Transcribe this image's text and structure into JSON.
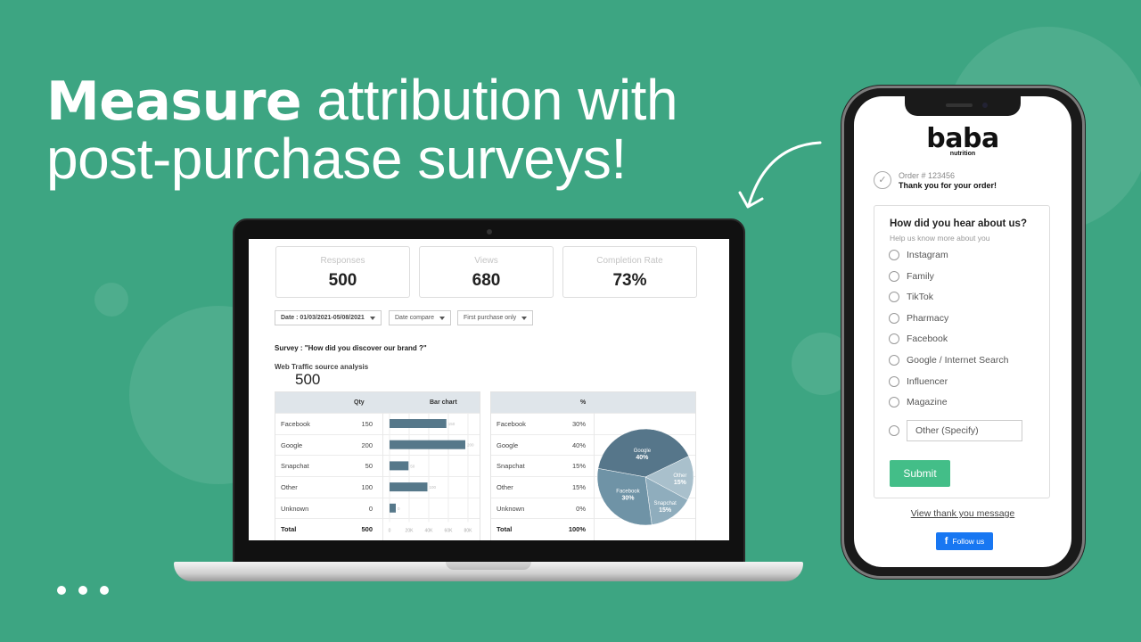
{
  "headline": {
    "bold": "Measure",
    "line1_rest": " attribution with",
    "line2": "post-purchase surveys!"
  },
  "dashboard": {
    "kpis": [
      {
        "label": "Responses",
        "value": "500"
      },
      {
        "label": "Views",
        "value": "680"
      },
      {
        "label": "Completion Rate",
        "value": "73%"
      }
    ],
    "filters": [
      {
        "label": "Date : 01/03/2021-05/08/2021"
      },
      {
        "label": "Date compare"
      },
      {
        "label": "First purchase only"
      }
    ],
    "survey_title": "Survey : \"How did you discover our brand ?\"",
    "analysis_label": "Web Traffic source analysis",
    "analysis_total": "500",
    "qty_table": {
      "headers": [
        "",
        "Qty",
        "Bar chart"
      ],
      "rows": [
        {
          "name": "Facebook",
          "qty": "150"
        },
        {
          "name": "Google",
          "qty": "200"
        },
        {
          "name": "Snapchat",
          "qty": "50"
        },
        {
          "name": "Other",
          "qty": "100"
        },
        {
          "name": "Unknown",
          "qty": "0"
        }
      ],
      "total": {
        "name": "Total",
        "qty": "500"
      }
    },
    "pct_table": {
      "headers": [
        "",
        "%"
      ],
      "rows": [
        {
          "name": "Facebook",
          "pct": "30%"
        },
        {
          "name": "Google",
          "pct": "40%"
        },
        {
          "name": "Snapchat",
          "pct": "15%"
        },
        {
          "name": "Other",
          "pct": "15%"
        },
        {
          "name": "Unknown",
          "pct": "0%"
        }
      ],
      "total": {
        "name": "Total",
        "pct": "100%"
      }
    }
  },
  "chart_data": [
    {
      "type": "bar",
      "orientation": "horizontal",
      "title": "Bar chart",
      "categories": [
        "Facebook",
        "Google",
        "Snapchat",
        "Other",
        "Unknown"
      ],
      "values": [
        150,
        200,
        50,
        100,
        0
      ],
      "data_labels": [
        "150",
        "200",
        "50",
        "100",
        "0"
      ],
      "x_tick_labels": [
        "0",
        "20K",
        "40K",
        "60K",
        "80K"
      ],
      "grid": true
    },
    {
      "type": "pie",
      "title": "%",
      "categories": [
        "Google",
        "Other",
        "Snapchat",
        "Facebook"
      ],
      "values": [
        40,
        15,
        15,
        30
      ],
      "labels": [
        "Google 40%",
        "Other 15%",
        "Snapchat 15%",
        "Facebook 30%"
      ],
      "colors": [
        "#56768a",
        "#a9c0cc",
        "#8fadbd",
        "#6f93a6"
      ]
    }
  ],
  "phone": {
    "brand": "baba",
    "brand_sub": "nutrition",
    "order_number": "Order # 123456",
    "thanks": "Thank you for your order!",
    "question": "How did you hear about us?",
    "question_sub": "Help us know more about you",
    "options": [
      "Instagram",
      "Family",
      "TikTok",
      "Pharmacy",
      "Facebook",
      "Google / Internet Search",
      "Influencer",
      "Magazine"
    ],
    "other_placeholder": "Other (Specify)",
    "submit_label": "Submit",
    "thank_you_link": "View thank you message",
    "follow_label": "Follow us",
    "accent_color": "#43be88",
    "facebook_color": "#1877f2"
  },
  "pagination_dots": 3
}
